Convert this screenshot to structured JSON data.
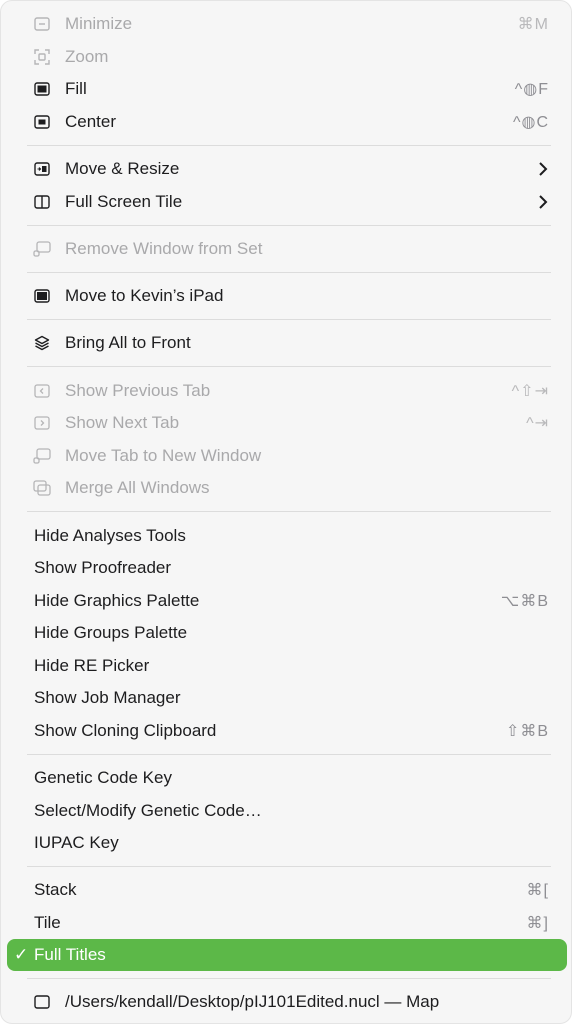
{
  "menu": {
    "minimize": {
      "label": "Minimize",
      "shortcut": "⌘M",
      "icon": "minimize-icon"
    },
    "zoom": {
      "label": "Zoom",
      "icon": "zoom-icon"
    },
    "fill": {
      "label": "Fill",
      "shortcut": "^◍F",
      "icon": "fill-icon"
    },
    "center": {
      "label": "Center",
      "shortcut": "^◍C",
      "icon": "center-icon"
    },
    "move_resize": {
      "label": "Move & Resize",
      "icon": "move-resize-icon"
    },
    "full_screen_tile": {
      "label": "Full Screen Tile",
      "icon": "split-view-icon"
    },
    "remove_window": {
      "label": "Remove Window from Set",
      "icon": "window-set-icon"
    },
    "move_to_ipad": {
      "label": "Move to Kevin’s iPad",
      "icon": "ipad-icon"
    },
    "bring_all_front": {
      "label": "Bring All to Front",
      "icon": "layers-icon"
    },
    "show_previous_tab": {
      "label": "Show Previous Tab",
      "shortcut": "^⇧⇥",
      "icon": "previous-tab-icon"
    },
    "show_next_tab": {
      "label": "Show Next Tab",
      "shortcut": "^⇥",
      "icon": "next-tab-icon"
    },
    "move_tab_new_window": {
      "label": "Move Tab to New Window",
      "icon": "tab-window-icon"
    },
    "merge_all_windows": {
      "label": "Merge All Windows",
      "icon": "merge-windows-icon"
    },
    "hide_analyses_tools": {
      "label": "Hide Analyses Tools"
    },
    "show_proofreader": {
      "label": "Show Proofreader"
    },
    "hide_graphics_palette": {
      "label": "Hide Graphics Palette",
      "shortcut": "⌥⌘B"
    },
    "hide_groups_palette": {
      "label": "Hide Groups Palette"
    },
    "hide_re_picker": {
      "label": "Hide RE Picker"
    },
    "show_job_manager": {
      "label": "Show Job Manager"
    },
    "show_cloning_clipboard": {
      "label": "Show Cloning Clipboard",
      "shortcut": "⇧⌘B"
    },
    "genetic_code_key": {
      "label": "Genetic Code Key"
    },
    "select_modify_genetic_code": {
      "label": "Select/Modify Genetic Code…"
    },
    "iupac_key": {
      "label": "IUPAC Key"
    },
    "stack": {
      "label": "Stack",
      "shortcut": "⌘["
    },
    "tile": {
      "label": "Tile",
      "shortcut": "⌘]"
    },
    "full_titles": {
      "label": "Full Titles",
      "checkmark": "✓"
    },
    "document_window": {
      "label": "/Users/kendall/Desktop/pIJ101Edited.nucl — Map",
      "icon": "window-icon"
    }
  },
  "colors": {
    "selected_background": "#5cb848",
    "menu_background": "#f6f6f6",
    "text": "#1d1d1f",
    "disabled_text": "#a9a9ab"
  }
}
